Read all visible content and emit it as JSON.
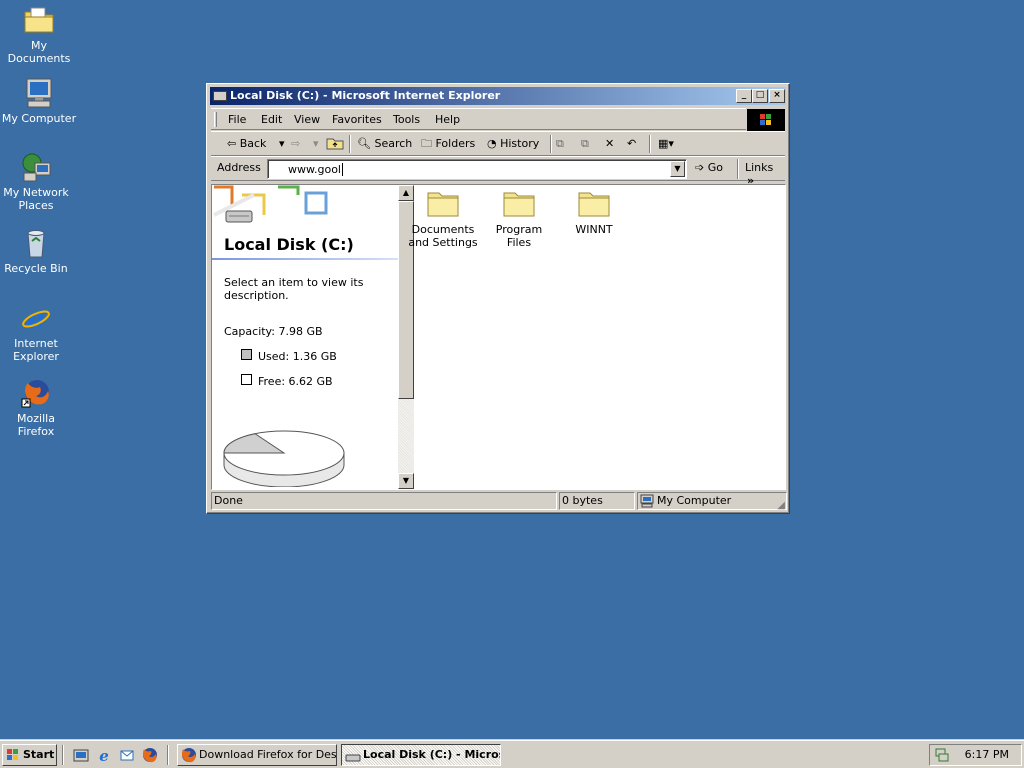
{
  "desktop": {
    "icons": [
      {
        "label": "My Documents",
        "icon": "my-documents-icon"
      },
      {
        "label": "My Computer",
        "icon": "my-computer-icon"
      },
      {
        "label": "My Network Places",
        "icon": "network-places-icon"
      },
      {
        "label": "Recycle Bin",
        "icon": "recycle-bin-icon"
      },
      {
        "label": "Internet Explorer",
        "icon": "internet-explorer-icon"
      },
      {
        "label": "Mozilla Firefox",
        "icon": "firefox-icon"
      }
    ],
    "background_color": "#3a6ea5"
  },
  "window": {
    "title": "Local Disk (C:) - Microsoft Internet Explorer",
    "controls": {
      "minimize": "_",
      "maximize": "□",
      "close": "×"
    },
    "menu": [
      "File",
      "Edit",
      "View",
      "Favorites",
      "Tools",
      "Help"
    ],
    "toolbar": {
      "back": "Back",
      "search": "Search",
      "folders": "Folders",
      "history": "History"
    },
    "address": {
      "label": "Address",
      "value": "www.gool",
      "go": "Go",
      "links": "Links"
    },
    "left_pane": {
      "title": "Local Disk (C:)",
      "description": "Select an item to view its description.",
      "capacity": "Capacity: 7.98 GB",
      "used": "Used: 1.36 GB",
      "free": "Free: 6.62 GB",
      "used_fraction": 0.17
    },
    "folders": [
      {
        "name": "Documents and Settings"
      },
      {
        "name": "Program Files"
      },
      {
        "name": "WINNT"
      }
    ],
    "status": {
      "text": "Done",
      "size": "0 bytes",
      "zone": "My Computer"
    }
  },
  "taskbar": {
    "start": "Start",
    "tasks": [
      {
        "label": "Download Firefox for Des...",
        "active": false
      },
      {
        "label": "Local Disk (C:) - Micros...",
        "active": true
      }
    ],
    "clock": "6:17 PM"
  }
}
